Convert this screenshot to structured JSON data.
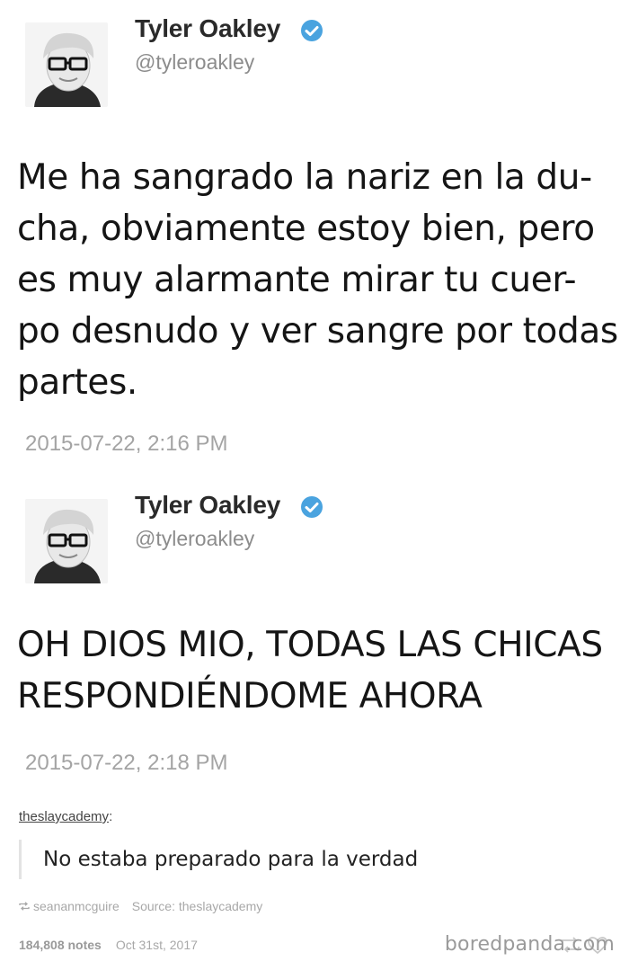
{
  "tweets": [
    {
      "name": "Tyler Oakley",
      "handle": "@tyleroakley",
      "text": "Me ha sangrado la nariz en la du-\ncha, obviamente estoy bien, pero\nes muy alarmante mirar tu cuer-\npo desnudo y ver sangre por todas\npartes.",
      "timestamp": "2015-07-22, 2:16 PM"
    },
    {
      "name": "Tyler Oakley",
      "handle": "@tyleroakley",
      "text": "OH DIOS MIO, TODAS LAS CHICAS\nRESPONDIÉNDOME AHORA",
      "timestamp": "2015-07-22, 2:18 PM"
    }
  ],
  "reblog": {
    "username": "theslaycademy",
    "colon": ":",
    "quote": "No estaba preparado para la verdad"
  },
  "footer": {
    "reblogged_from": "seananmcguire",
    "source_label": "Source: theslaycademy",
    "notes": "184,808 notes",
    "date": "Oct 31st, 2017"
  },
  "watermark": "boredpanda.com",
  "colors": {
    "verified_blue": "#4aa3df",
    "timestamp_gray": "#a4a4a4",
    "text_dark": "#151515"
  },
  "icons": {
    "verified": "verified-badge-icon",
    "reblog": "reblog-icon",
    "heart": "heart-icon"
  }
}
